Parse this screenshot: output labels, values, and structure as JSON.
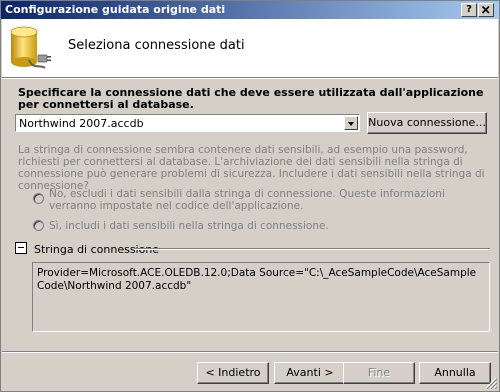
{
  "window": {
    "title": "Configurazione guidata origine dati",
    "help_label": "?",
    "close_label": "X"
  },
  "header": {
    "title": "Seleziona connessione dati",
    "icon": "database-plug-icon"
  },
  "prompt": "Specificare la connessione dati che deve essere utilizzata dall'applicazione per connettersi al database.",
  "connection_combo": {
    "selected": "Northwind 2007.accdb"
  },
  "new_connection_label": "Nuova connessione...",
  "sensitive_info": "La stringa di connessione sembra contenere dati sensibili, ad esempio una password, richiesti per connettersi al database. L'archiviazione dei dati sensibili nella stringa di connessione può generare problemi di sicurezza. Includere i dati sensibili nella stringa di connessione?",
  "options": {
    "no_label": "No, escludi i dati sensibili dalla stringa di connessione. Queste informazioni verranno impostate nel codice dell'applicazione.",
    "yes_label": "Sì, includi i dati sensibili nella stringa di connessione."
  },
  "connection_string_group": {
    "label": "Stringa di connessione",
    "value": "Provider=Microsoft.ACE.OLEDB.12.0;Data Source=\"C:\\_AceSampleCode\\AceSampleCode\\Northwind 2007.accdb\""
  },
  "footer": {
    "back_label": "< Indietro",
    "next_label": "Avanti >",
    "finish_label": "Fine",
    "cancel_label": "Annulla"
  },
  "colors": {
    "titlebar_start": "#0a246a",
    "titlebar_end": "#a6caf0",
    "face": "#d4d0c8"
  }
}
